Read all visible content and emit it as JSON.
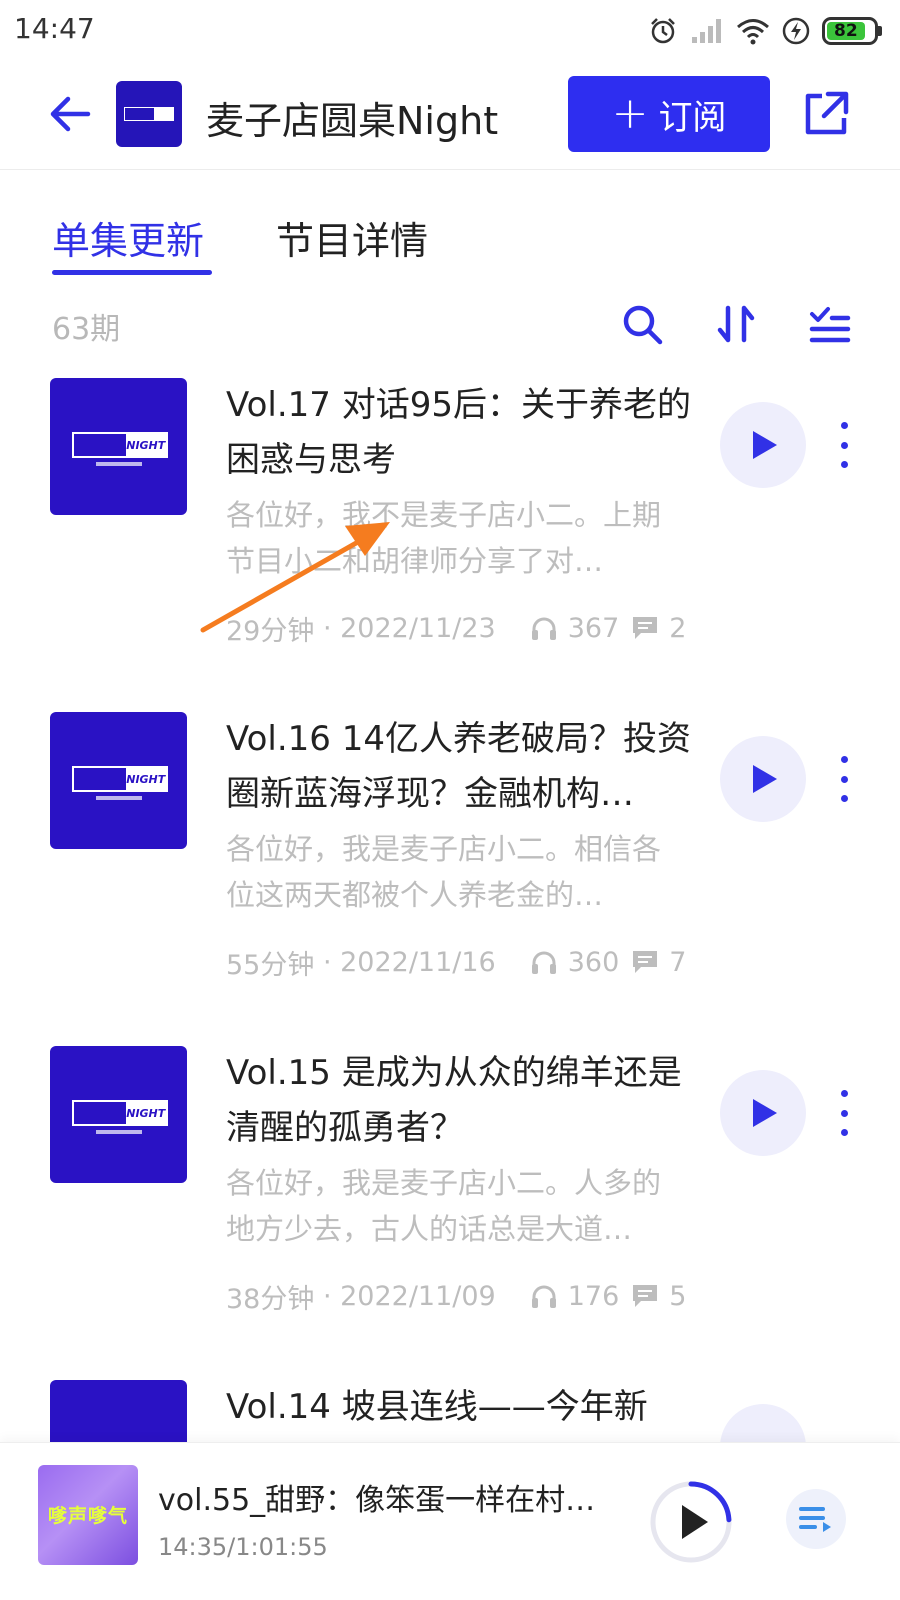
{
  "status_bar": {
    "time": "14:47",
    "battery": "82",
    "icons": [
      "alarm-icon",
      "signal-icon",
      "wifi-icon",
      "charging-icon",
      "battery-icon"
    ]
  },
  "header": {
    "title": "麦子店圆桌Night",
    "subscribe_label": "订阅",
    "subscribe_plus": "+",
    "accent_color": "#2e2ef0"
  },
  "tabs": [
    {
      "label": "单集更新",
      "active": true
    },
    {
      "label": "节目详情",
      "active": false
    }
  ],
  "toolbar": {
    "episode_count": "63期",
    "icons": [
      "search-icon",
      "sort-icon",
      "batch-select-icon"
    ]
  },
  "episodes": [
    {
      "title": "Vol.17 对话95后：关于养老的困惑与思考",
      "description": "各位好，我不是麦子店小二。上期节目小二和胡律师分享了对…",
      "duration": "29分钟",
      "date": "2022/11/23",
      "plays": "367",
      "comments": "2"
    },
    {
      "title": "Vol.16 14亿人养老破局？投资圈新蓝海浮现？金融机构…",
      "description": "各位好，我是麦子店小二。相信各位这两天都被个人养老金的…",
      "duration": "55分钟",
      "date": "2022/11/16",
      "plays": "360",
      "comments": "7"
    },
    {
      "title": "Vol.15 是成为从众的绵羊还是清醒的孤勇者？",
      "description": "各位好，我是麦子店小二。人多的地方少去，古人的话总是大道…",
      "duration": "38分钟",
      "date": "2022/11/09",
      "plays": "176",
      "comments": "5"
    },
    {
      "title": "Vol.14 坡县连线——今年新",
      "description": "",
      "duration": "",
      "date": "",
      "plays": "",
      "comments": ""
    }
  ],
  "cover_logo": {
    "right_text": "NIGHT"
  },
  "mini_player": {
    "title": "vol.55_甜野：像笨蛋一样在村…",
    "time": "14:35/1:01:55",
    "cover_text": "嗲声嗲气",
    "progress": 0.24
  },
  "annotation": {
    "arrow_color": "#f57c1f"
  }
}
